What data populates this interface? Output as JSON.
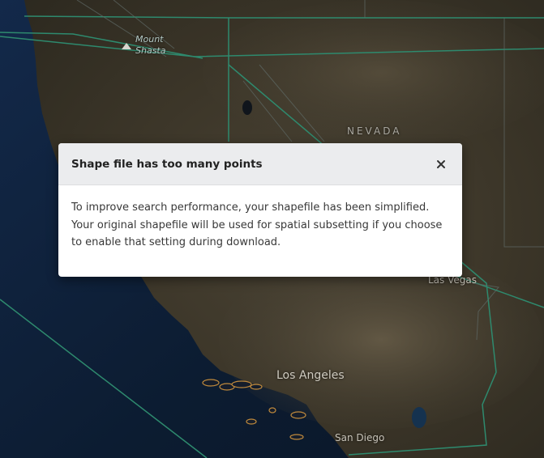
{
  "map": {
    "labels": {
      "mount_shasta_line1": "Mount",
      "mount_shasta_line2": "Shasta",
      "nevada": "NEVADA",
      "los_angeles": "Los Angeles",
      "las_vegas": "Las Vegas",
      "san_diego": "San Diego"
    },
    "colors": {
      "ocean": "#0e1f33",
      "land": "#3a3528",
      "boundary": "#2e8a6e",
      "island_outline": "#c08a3c"
    }
  },
  "modal": {
    "title": "Shape file has too many points",
    "close_symbol": "×",
    "body": "To improve search performance, your shapefile has been simplified. Your original shapefile will be used for spatial subsetting if you choose to enable that setting during download."
  }
}
